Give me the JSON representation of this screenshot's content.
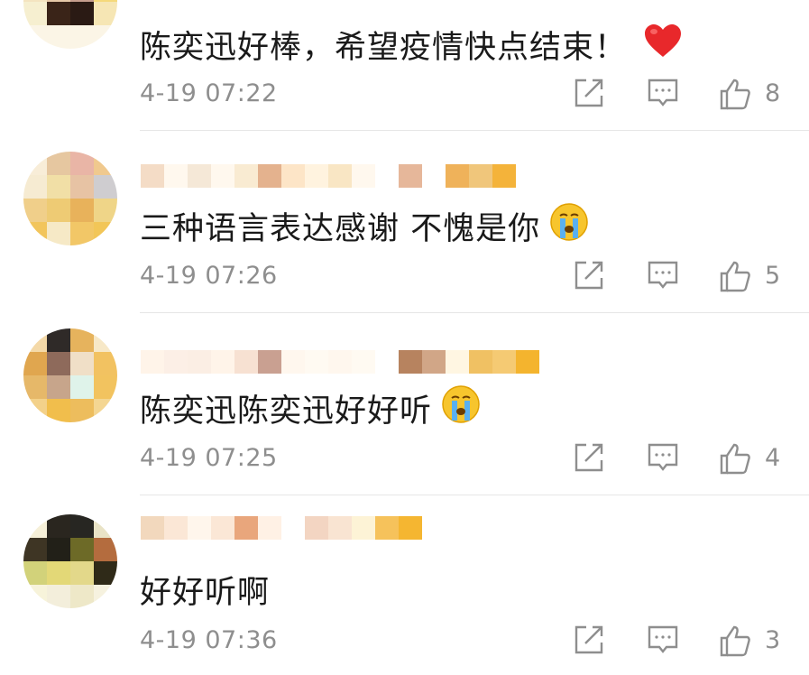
{
  "comments": [
    {
      "text": "陈奕迅好棒，希望疫情快点结束！",
      "emoji": "red-heart",
      "time": "4-19 07:22",
      "likes": "8",
      "avatar_colors": [
        "#f3dfb5",
        "#d8a78e",
        "#c59d8d",
        "#f5d97a",
        "#f6efd0",
        "#3a2418",
        "#2a1a14",
        "#f6e6b4"
      ],
      "username_colors": []
    },
    {
      "text": "三种语言表达感谢 不愧是你",
      "emoji": "crying-face",
      "time": "4-19 07:26",
      "likes": "5",
      "avatar_colors": [
        "#e6c7a0",
        "#e9b5a6",
        "#f0c98e",
        "#f6ebd2",
        "#f1dfa6",
        "#e7c3a4",
        "#cfcdd0",
        "#f0cf8a",
        "#eecb74",
        "#e8b25b",
        "#efd588",
        "#f2c55c",
        "#f6e9c6",
        "#f2c767",
        "#f2c658",
        "#f7e7bd"
      ],
      "username_colors": [
        "#f4dcc6",
        "#fff8ee",
        "#f5e8d7",
        "#f9ebd2",
        "#e4b28e",
        "#fde5c7",
        "#fff3df",
        "#f9e6c4",
        "#e6b79a",
        "#ffffff",
        "#efb25a",
        "#f0c67b",
        "#f4b33a"
      ]
    },
    {
      "text": "陈奕迅陈奕迅好好听",
      "emoji": "crying-face",
      "time": "4-19 07:25",
      "likes": "4",
      "avatar_colors": [
        "#f4d9a8",
        "#2f2a28",
        "#e6b35d",
        "#f7e8c7",
        "#e0a64f",
        "#8e6a5b",
        "#f0dfc7",
        "#f2c261",
        "#e6b869",
        "#c7a58b",
        "#dff3ea",
        "#f2c35f",
        "#f3d18a",
        "#f1be4c",
        "#edbd5d",
        "#f4d692"
      ],
      "username_colors": [
        "#fff4e9",
        "#fcefe6",
        "#fbeee4",
        "#f7e1d2",
        "#c9a091",
        "#fff7ee",
        "#fffaf2",
        "#b7835f",
        "#d1a687",
        "#fff6e2",
        "#f0c163",
        "#f5ca73",
        "#f4b42e"
      ]
    },
    {
      "text": "好好听啊",
      "emoji": "",
      "time": "4-19 07:36",
      "likes": "3",
      "avatar_colors": [
        "#f6f0d8",
        "#2a261f",
        "#272622",
        "#e9e3c6",
        "#3e3524",
        "#222018",
        "#6d6a27",
        "#b46c3e",
        "#d2d27a",
        "#e3d877",
        "#e3d88a",
        "#2f2a18",
        "#f7f3da",
        "#f3eedb",
        "#eee8c8",
        "#f6f2df"
      ],
      "username_colors": [
        "#f2d8bd",
        "#fbe7d6",
        "#fff6ec",
        "#e9a67c",
        "#fff1e5",
        "#f3d5c2",
        "#f9e4d2",
        "#fdf3d6",
        "#f6c25b",
        "#f5b631"
      ]
    }
  ]
}
